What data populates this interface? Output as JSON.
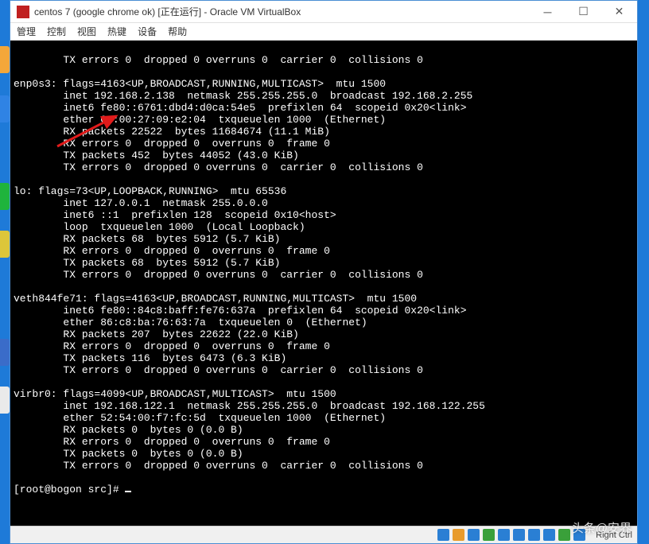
{
  "window": {
    "title": "centos 7 (google chrome ok) [正在运行] - Oracle VM VirtualBox"
  },
  "menu": {
    "manage": "管理",
    "control": "控制",
    "view": "视图",
    "hotkey": "热键",
    "device": "设备",
    "help": "帮助"
  },
  "terminal": {
    "l0": "        TX errors 0  dropped 0 overruns 0  carrier 0  collisions 0",
    "l1": "",
    "l2": "enp0s3: flags=4163<UP,BROADCAST,RUNNING,MULTICAST>  mtu 1500",
    "l3": "        inet 192.168.2.138  netmask 255.255.255.0  broadcast 192.168.2.255",
    "l4": "        inet6 fe80::6761:dbd4:d0ca:54e5  prefixlen 64  scopeid 0x20<link>",
    "l5": "        ether 08:00:27:09:e2:04  txqueuelen 1000  (Ethernet)",
    "l6": "        RX packets 22522  bytes 11684674 (11.1 MiB)",
    "l7": "        RX errors 0  dropped 0  overruns 0  frame 0",
    "l8": "        TX packets 452  bytes 44052 (43.0 KiB)",
    "l9": "        TX errors 0  dropped 0 overruns 0  carrier 0  collisions 0",
    "l10": "",
    "l11": "lo: flags=73<UP,LOOPBACK,RUNNING>  mtu 65536",
    "l12": "        inet 127.0.0.1  netmask 255.0.0.0",
    "l13": "        inet6 ::1  prefixlen 128  scopeid 0x10<host>",
    "l14": "        loop  txqueuelen 1000  (Local Loopback)",
    "l15": "        RX packets 68  bytes 5912 (5.7 KiB)",
    "l16": "        RX errors 0  dropped 0  overruns 0  frame 0",
    "l17": "        TX packets 68  bytes 5912 (5.7 KiB)",
    "l18": "        TX errors 0  dropped 0 overruns 0  carrier 0  collisions 0",
    "l19": "",
    "l20": "veth844fe71: flags=4163<UP,BROADCAST,RUNNING,MULTICAST>  mtu 1500",
    "l21": "        inet6 fe80::84c8:baff:fe76:637a  prefixlen 64  scopeid 0x20<link>",
    "l22": "        ether 86:c8:ba:76:63:7a  txqueuelen 0  (Ethernet)",
    "l23": "        RX packets 207  bytes 22622 (22.0 KiB)",
    "l24": "        RX errors 0  dropped 0  overruns 0  frame 0",
    "l25": "        TX packets 116  bytes 6473 (6.3 KiB)",
    "l26": "        TX errors 0  dropped 0 overruns 0  carrier 0  collisions 0",
    "l27": "",
    "l28": "virbr0: flags=4099<UP,BROADCAST,MULTICAST>  mtu 1500",
    "l29": "        inet 192.168.122.1  netmask 255.255.255.0  broadcast 192.168.122.255",
    "l30": "        ether 52:54:00:f7:fc:5d  txqueuelen 1000  (Ethernet)",
    "l31": "        RX packets 0  bytes 0 (0.0 B)",
    "l32": "        RX errors 0  dropped 0  overruns 0  frame 0",
    "l33": "        TX packets 0  bytes 0 (0.0 B)",
    "l34": "        TX errors 0  dropped 0 overruns 0  carrier 0  collisions 0",
    "l35": "",
    "prompt": "[root@bogon src]# "
  },
  "statusbar": {
    "host_key": "Right Ctrl"
  },
  "watermark": "头条@安界"
}
